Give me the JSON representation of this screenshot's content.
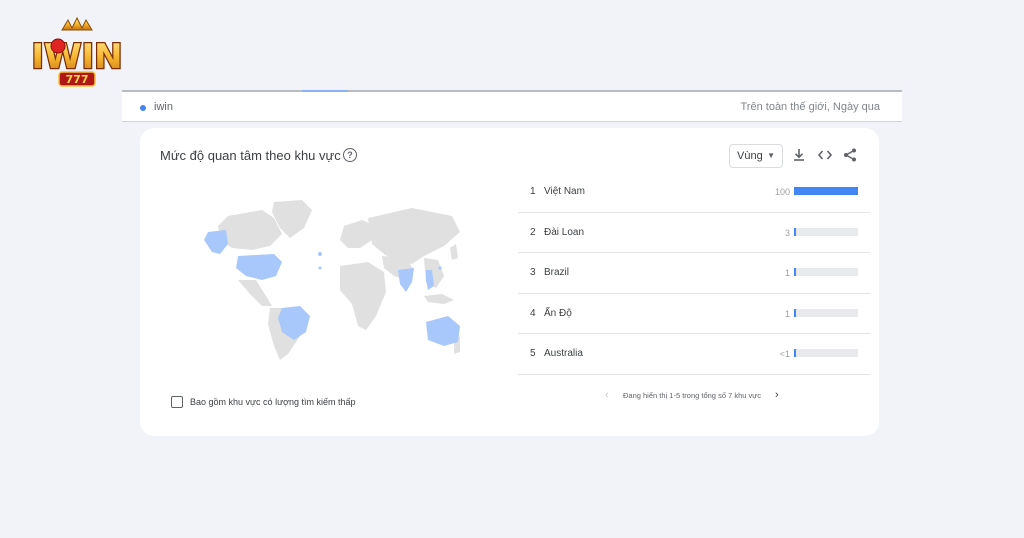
{
  "logo": {
    "text": "IWIN",
    "sub": "777"
  },
  "search_strip": {
    "term": "iwin",
    "scope": "Trên toàn thế giới, Ngày qua"
  },
  "card": {
    "title": "Mức độ quan tâm theo khu vực",
    "help_icon": "help-circle-icon",
    "region_select": "Vùng",
    "tools": [
      "download-icon",
      "embed-code-icon",
      "share-icon"
    ],
    "checkbox_label": "Bao gồm khu vực có lượng tìm kiếm thấp",
    "regions": [
      {
        "rank": "1",
        "name": "Việt Nam",
        "value": "100",
        "fraction": 1.0
      },
      {
        "rank": "2",
        "name": "Đài Loan",
        "value": "3",
        "fraction": 0.03
      },
      {
        "rank": "3",
        "name": "Brazil",
        "value": "1",
        "fraction": 0.01
      },
      {
        "rank": "4",
        "name": "Ấn Độ",
        "value": "1",
        "fraction": 0.01
      },
      {
        "rank": "5",
        "name": "Australia",
        "value": "<1",
        "fraction": 0.005
      }
    ],
    "pagination": "Đang hiển thị 1-5 trong tổng số 7 khu vực"
  },
  "colors": {
    "accent": "#4285f4",
    "map_highlight": "#a8c7fa",
    "map_land": "#e0e0e0"
  }
}
